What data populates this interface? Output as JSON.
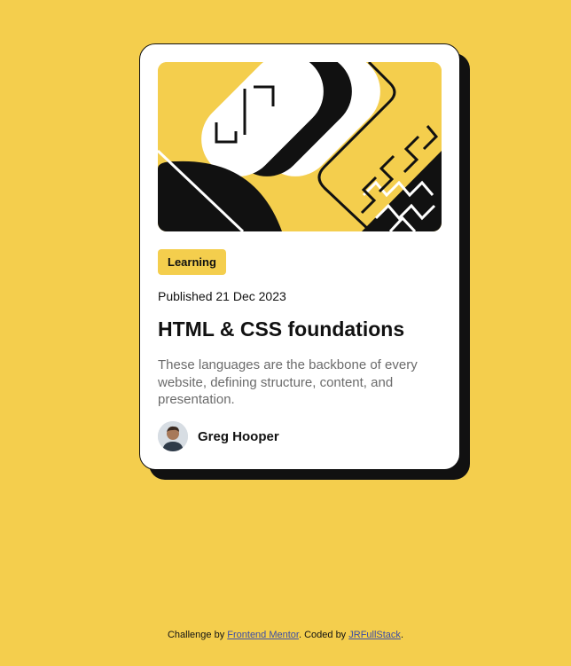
{
  "card": {
    "image_alt": "illustration-article",
    "tag": "Learning",
    "published": "Published 21 Dec 2023",
    "title": "HTML & CSS foundations",
    "description": "These languages are the backbone of every website, defining structure, content, and presentation.",
    "author": {
      "name": "Greg Hooper",
      "avatar_icon": "user-avatar-photo"
    }
  },
  "attribution": {
    "prefix": "Challenge by ",
    "challenge_link": "Frontend Mentor",
    "middle": ". Coded by ",
    "coder_link": "JRFullStack",
    "suffix": "."
  },
  "colors": {
    "background": "#F4CE4D",
    "card": "#FFFFFF",
    "ink": "#111111",
    "muted_text": "#6B6B6B",
    "link": "#3A4CA8"
  }
}
